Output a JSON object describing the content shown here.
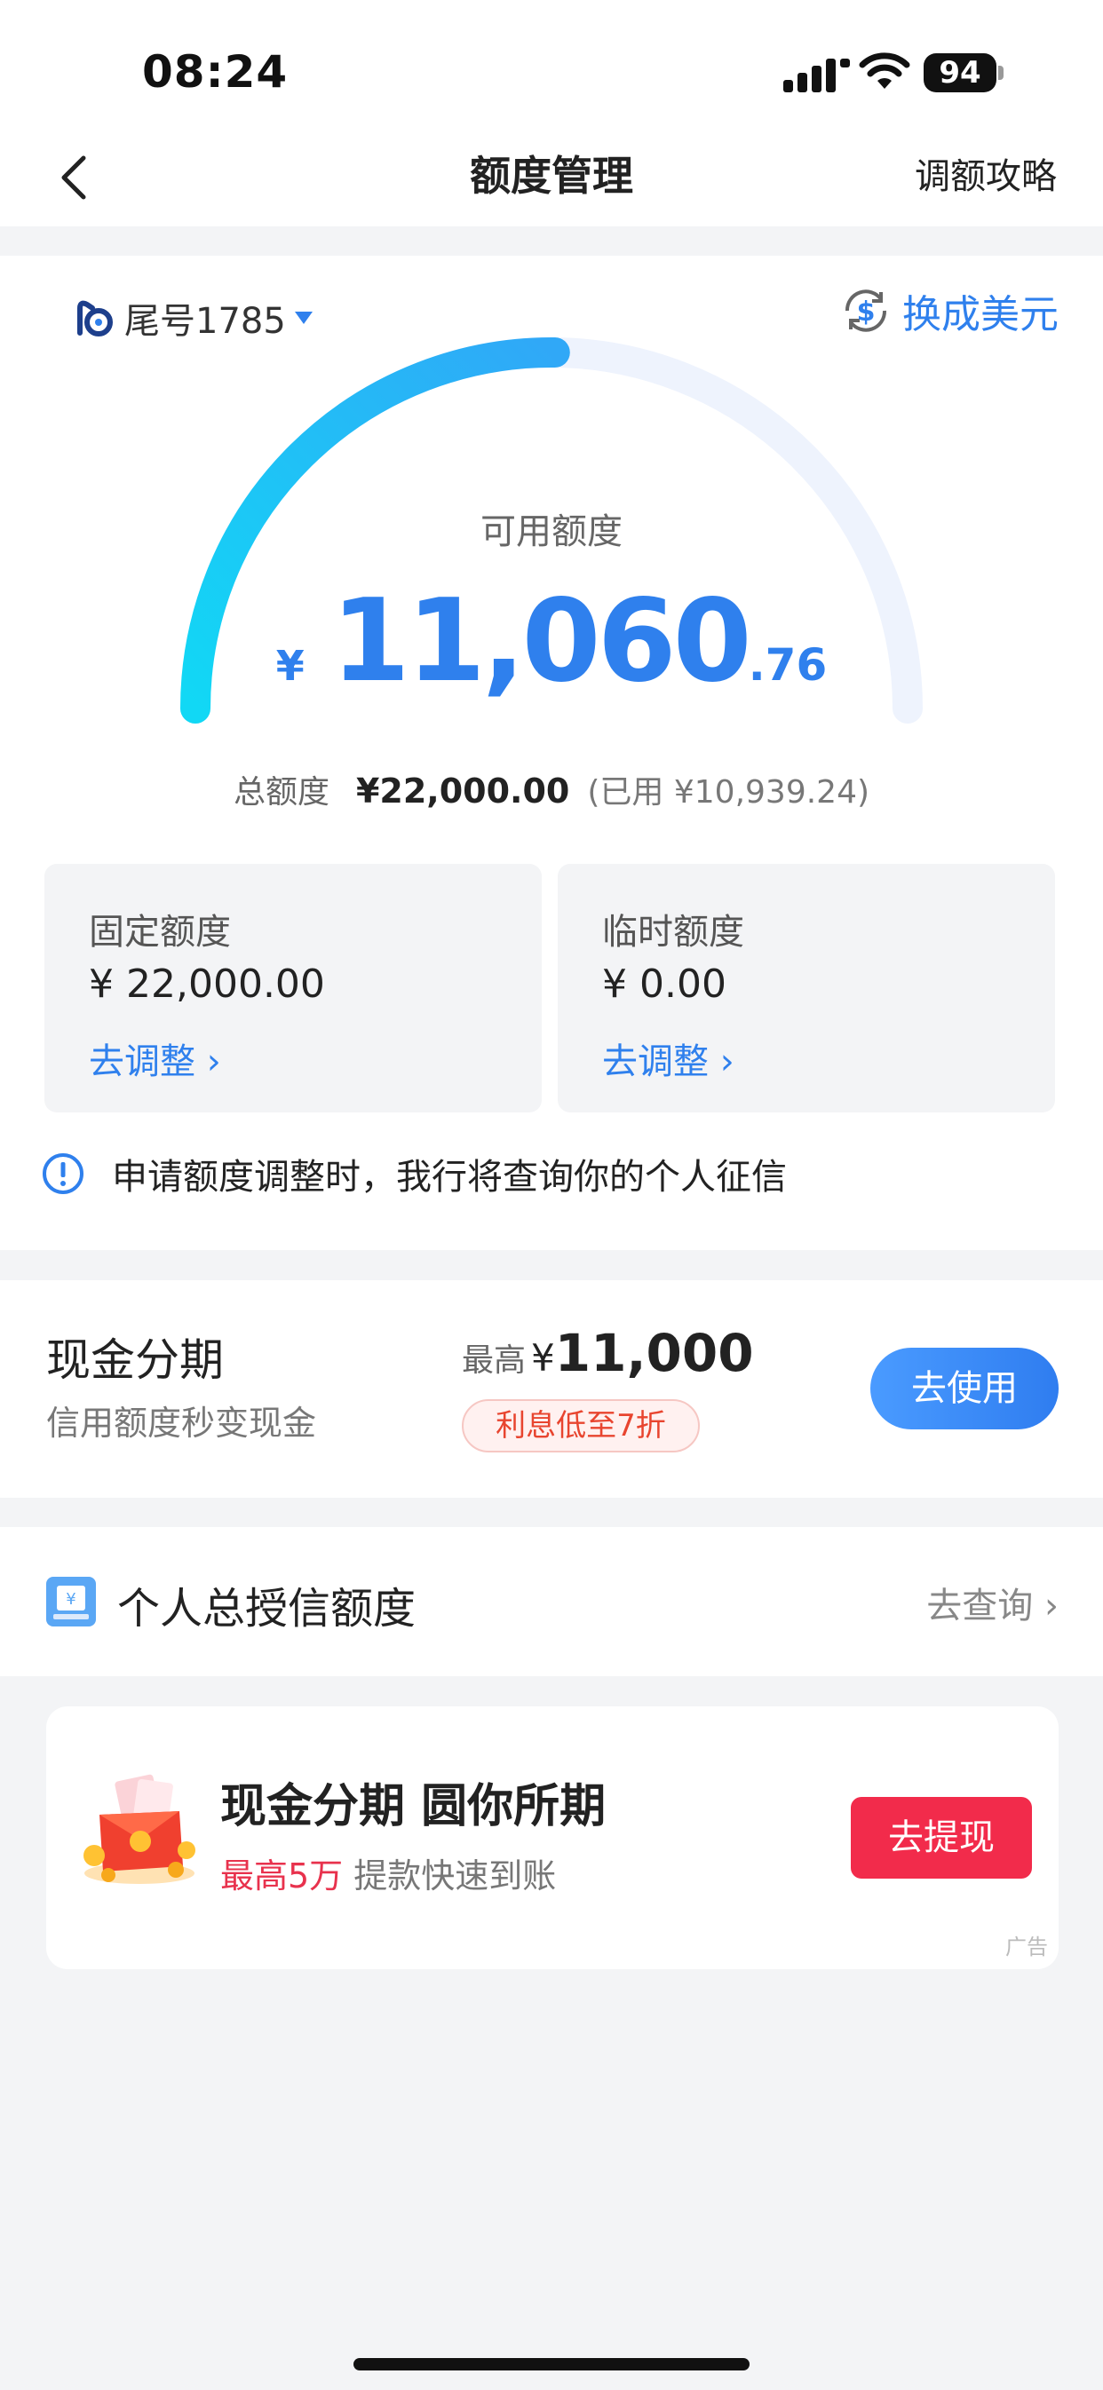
{
  "status": {
    "time": "08:24",
    "battery": "94"
  },
  "nav": {
    "title": "额度管理",
    "right": "调额攻略"
  },
  "account": {
    "label": "尾号1785",
    "switch_currency": "换成美元"
  },
  "gauge": {
    "label": "可用额度",
    "currency": "¥",
    "amount_int": "11,060",
    "amount_dec": ".76",
    "available_fraction": 0.503,
    "total_label": "总额度",
    "total_value": "¥22,000.00",
    "used": "(已用 ¥10,939.24)"
  },
  "fixed": {
    "title": "固定额度",
    "value": "¥ 22,000.00",
    "action": "去调整 ›"
  },
  "temp": {
    "title": "临时额度",
    "value": "¥ 0.00",
    "action": "去调整 ›"
  },
  "notice": {
    "text": "申请额度调整时，我行将查询你的个人征信"
  },
  "cash": {
    "title": "现金分期",
    "subtitle": "信用额度秒变现金",
    "max_label": "最高",
    "max_currency": "¥",
    "max_value": "11,000",
    "tag": "利息低至7折",
    "button": "去使用"
  },
  "credit": {
    "title": "个人总授信额度",
    "link": "去查询 ›"
  },
  "ad": {
    "title": "现金分期 圆你所期",
    "sub_highlight": "最高5万",
    "sub_text": "提款快速到账",
    "button": "去提现",
    "tag": "广告"
  },
  "colors": {
    "accent": "#2f80ed",
    "gauge_start": "#11d8f5",
    "gauge_end": "#30a8f7",
    "ad_button": "#f22b4b"
  }
}
